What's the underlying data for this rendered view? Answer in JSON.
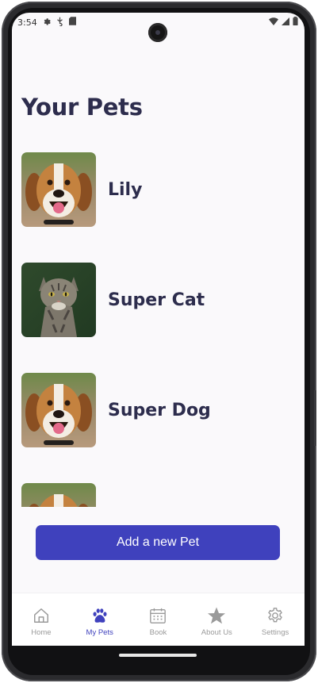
{
  "status_bar": {
    "time": "3:54",
    "left_icons": [
      "gear-icon",
      "usb-icon",
      "sd-card-icon"
    ],
    "right_icons": [
      "wifi-icon",
      "signal-icon",
      "battery-icon"
    ]
  },
  "page": {
    "title": "Your Pets"
  },
  "pets": [
    {
      "name": "Lily",
      "photo": "dog"
    },
    {
      "name": "Super Cat",
      "photo": "cat"
    },
    {
      "name": "Super Dog",
      "photo": "dog"
    },
    {
      "name": "",
      "photo": "dog"
    }
  ],
  "actions": {
    "add_pet_label": "Add a new Pet"
  },
  "bottom_nav": {
    "items": [
      {
        "label": "Home",
        "icon": "home-icon"
      },
      {
        "label": "My Pets",
        "icon": "paw-icon",
        "active": true
      },
      {
        "label": "Book",
        "icon": "calendar-icon"
      },
      {
        "label": "About Us",
        "icon": "star-icon"
      },
      {
        "label": "Settings",
        "icon": "gear-icon"
      }
    ]
  },
  "colors": {
    "primary": "#3f41bd",
    "title_text": "#2d2d4d",
    "nav_inactive": "#9a9a9a",
    "background": "#faf9fb"
  }
}
